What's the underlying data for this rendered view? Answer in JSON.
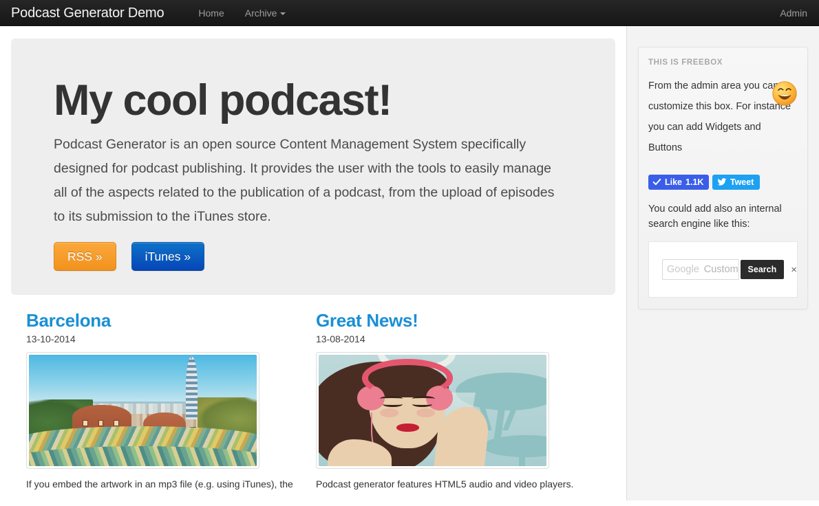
{
  "navbar": {
    "brand": "Podcast Generator Demo",
    "links": [
      {
        "label": "Home",
        "name": "nav-home"
      },
      {
        "label": "Archive",
        "name": "nav-archive",
        "caret": true
      }
    ],
    "admin_label": "Admin"
  },
  "jumbotron": {
    "title": "My cool podcast!",
    "text": "Podcast Generator is an open source Content Management System specifically designed for podcast publishing. It provides the user with the tools to easily manage all of the aspects related to the publication of a podcast, from the upload of episodes to its submission to the iTunes store.",
    "rss_label": "RSS »",
    "itunes_label": "iTunes »",
    "rss_color": "#f2921d",
    "itunes_color": "#0646b8"
  },
  "episodes": [
    {
      "title": "Barcelona",
      "date": "13-10-2014",
      "artwork_name": "barcelona-park-guell-photo",
      "description": "If you embed the artwork in an mp3 file (e.g. using iTunes), the"
    },
    {
      "title": "Great News!",
      "date": "13-08-2014",
      "artwork_name": "woman-with-headphones-illustration",
      "description": "Podcast generator features HTML5 audio and video players."
    }
  ],
  "sidebar": {
    "freebox_title": "THIS IS FREEBOX",
    "freebox_text": "From the admin area you can customize this box. For instance you can add Widgets and Buttons",
    "emoji_name": "grinning-face-emoji",
    "facebook": {
      "label": "Like",
      "count": "1.1K",
      "color": "#3b5ee8"
    },
    "twitter": {
      "label": "Tweet",
      "color": "#1da1f2"
    },
    "search_note": "You could add also an internal search engine like this:",
    "gcse": {
      "brand": "Google",
      "placeholder": "Custom Se",
      "button_label": "Search",
      "clear_label": "×"
    }
  },
  "theme": {
    "navbar_bg": "#161616",
    "jumbotron_bg": "#eeeeee",
    "link_blue": "#1a8fd4",
    "sidebar_bg": "#f3f3f3"
  }
}
